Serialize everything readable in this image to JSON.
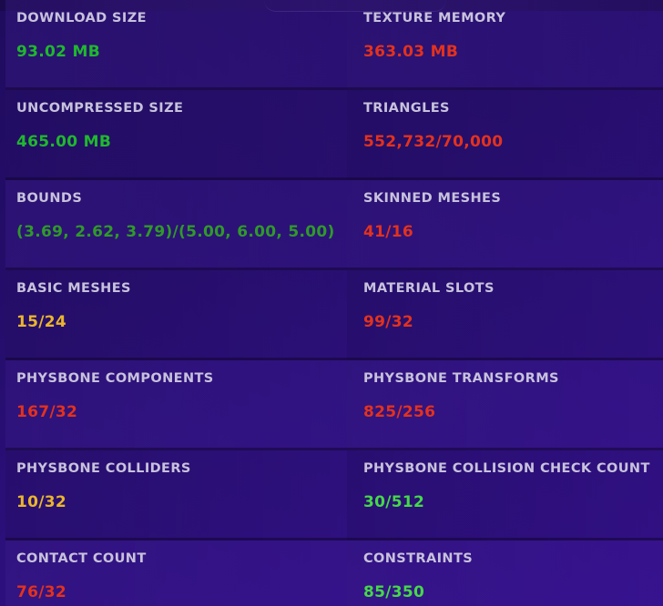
{
  "colors": {
    "green": "#1fb82e",
    "green_olive": "#2f9a2a",
    "green_light": "#45d84a",
    "red": "#e2321e",
    "yellow": "#eab52e",
    "label": "#c7c2dc",
    "background": "#240d6a"
  },
  "stats": [
    {
      "label": "DOWNLOAD SIZE",
      "value": "93.02 MB",
      "status": "good"
    },
    {
      "label": "TEXTURE MEMORY",
      "value": "363.03 MB",
      "status": "bad"
    },
    {
      "label": "UNCOMPRESSED SIZE",
      "value": "465.00 MB",
      "status": "good"
    },
    {
      "label": "TRIANGLES",
      "value": "552,732/70,000",
      "status": "bad"
    },
    {
      "label": "BOUNDS",
      "value": "(3.69, 2.62, 3.79)/(5.00, 6.00, 5.00)",
      "status": "good"
    },
    {
      "label": "SKINNED MESHES",
      "value": "41/16",
      "status": "bad"
    },
    {
      "label": "BASIC MESHES",
      "value": "15/24",
      "status": "warn"
    },
    {
      "label": "MATERIAL SLOTS",
      "value": "99/32",
      "status": "bad"
    },
    {
      "label": "PHYSBONE COMPONENTS",
      "value": "167/32",
      "status": "bad"
    },
    {
      "label": "PHYSBONE TRANSFORMS",
      "value": "825/256",
      "status": "bad"
    },
    {
      "label": "PHYSBONE COLLIDERS",
      "value": "10/32",
      "status": "warn"
    },
    {
      "label": "PHYSBONE COLLISION CHECK COUNT",
      "value": "30/512",
      "status": "good"
    },
    {
      "label": "CONTACT COUNT",
      "value": "76/32",
      "status": "bad"
    },
    {
      "label": "CONSTRAINTS",
      "value": "85/350",
      "status": "good"
    }
  ]
}
